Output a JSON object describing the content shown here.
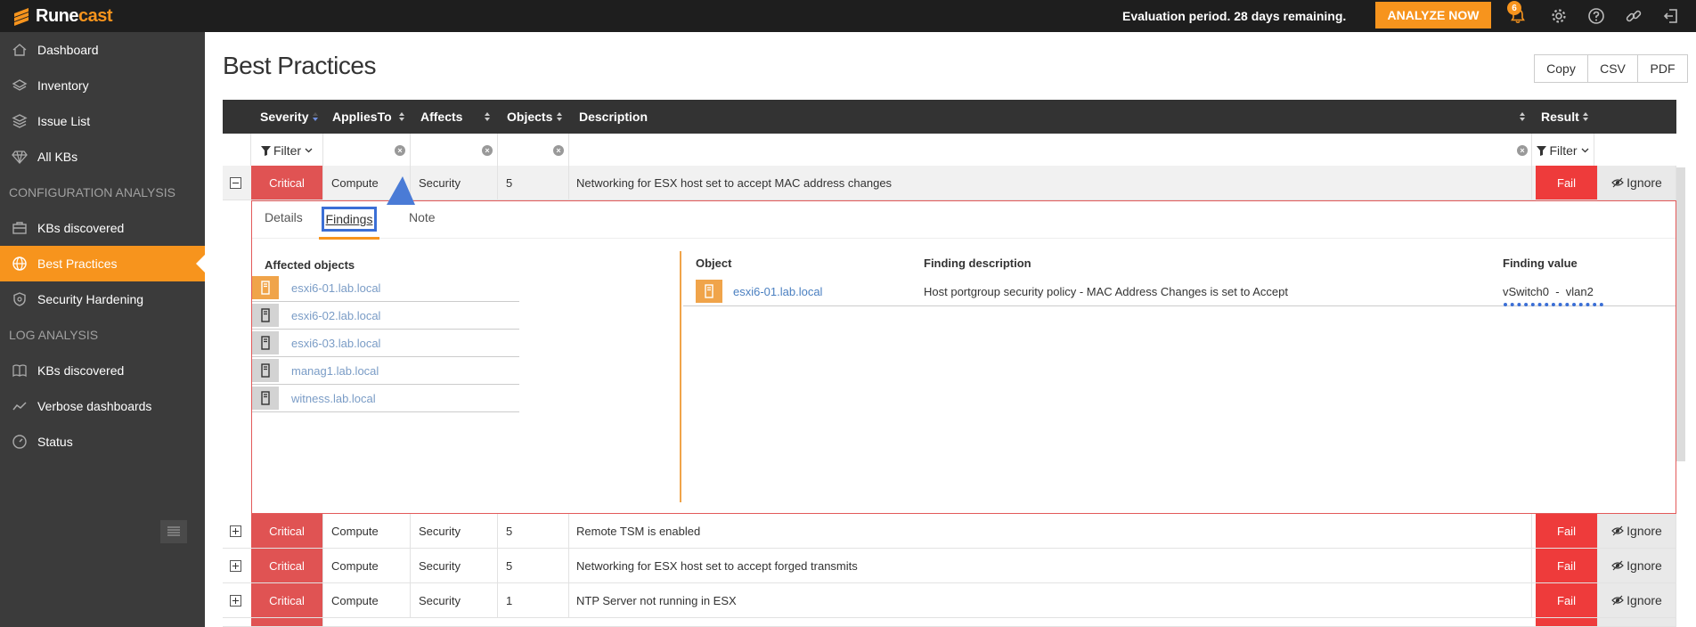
{
  "brand": {
    "name_a": "Rune",
    "name_b": "cast",
    "accent": "#f7941d"
  },
  "topbar": {
    "evaluation_text": "Evaluation period. 28 days remaining.",
    "analyze_label": "ANALYZE NOW",
    "notification_count": "6",
    "icons": [
      "bell-icon",
      "gear-icon",
      "help-icon",
      "link-icon",
      "logout-icon"
    ]
  },
  "sidebar": {
    "items": [
      {
        "label": "Dashboard",
        "icon": "home-icon"
      },
      {
        "label": "Inventory",
        "icon": "layers-icon"
      },
      {
        "label": "Issue List",
        "icon": "stack-icon"
      },
      {
        "label": "All KBs",
        "icon": "diamond-icon"
      }
    ],
    "section_config": "CONFIGURATION ANALYSIS",
    "config_items": [
      {
        "label": "KBs discovered",
        "icon": "briefcase-icon"
      },
      {
        "label": "Best Practices",
        "icon": "globe-icon",
        "active": true
      },
      {
        "label": "Security Hardening",
        "icon": "shield-icon"
      }
    ],
    "section_log": "LOG ANALYSIS",
    "log_items": [
      {
        "label": "KBs discovered",
        "icon": "book-icon"
      },
      {
        "label": "Verbose dashboards",
        "icon": "chart-line-icon"
      },
      {
        "label": "Status",
        "icon": "gauge-icon"
      }
    ]
  },
  "page": {
    "title": "Best Practices",
    "export": {
      "copy": "Copy",
      "csv": "CSV",
      "pdf": "PDF"
    }
  },
  "table": {
    "headers": {
      "severity": "Severity",
      "applies_to": "AppliesTo",
      "affects": "Affects",
      "objects": "Objects",
      "description": "Description",
      "result": "Result"
    },
    "filter_label": "Filter",
    "ignore_label": "Ignore",
    "rows": [
      {
        "severity": "Critical",
        "applies_to": "Compute",
        "affects": "Security",
        "objects": "5",
        "description": "Networking for ESX host set to accept MAC address changes",
        "result": "Fail"
      },
      {
        "severity": "Critical",
        "applies_to": "Compute",
        "affects": "Security",
        "objects": "5",
        "description": "Remote TSM is enabled",
        "result": "Fail"
      },
      {
        "severity": "Critical",
        "applies_to": "Compute",
        "affects": "Security",
        "objects": "5",
        "description": "Networking for ESX host set to accept forged transmits",
        "result": "Fail"
      },
      {
        "severity": "Critical",
        "applies_to": "Compute",
        "affects": "Security",
        "objects": "1",
        "description": "NTP Server not running in ESX",
        "result": "Fail"
      }
    ]
  },
  "details": {
    "tabs": {
      "details": "Details",
      "findings": "Findings",
      "note": "Note"
    },
    "affected_title": "Affected objects",
    "affected": [
      {
        "name": "esxi6-01.lab.local",
        "status": "warn"
      },
      {
        "name": "esxi6-02.lab.local",
        "status": "ok"
      },
      {
        "name": "esxi6-03.lab.local",
        "status": "ok"
      },
      {
        "name": "manag1.lab.local",
        "status": "ok"
      },
      {
        "name": "witness.lab.local",
        "status": "ok"
      }
    ],
    "findings_headers": {
      "object": "Object",
      "description": "Finding description",
      "value": "Finding value"
    },
    "finding": {
      "object": "esxi6-01.lab.local",
      "description": "Host portgroup security policy - MAC Address Changes is set to Accept",
      "value": "vSwitch0  -  vlan2"
    }
  },
  "colors": {
    "critical": "#e05353",
    "fail": "#ee3b3b",
    "highlight": "#3b6fd6",
    "sidebar": "#3b3b3b"
  }
}
